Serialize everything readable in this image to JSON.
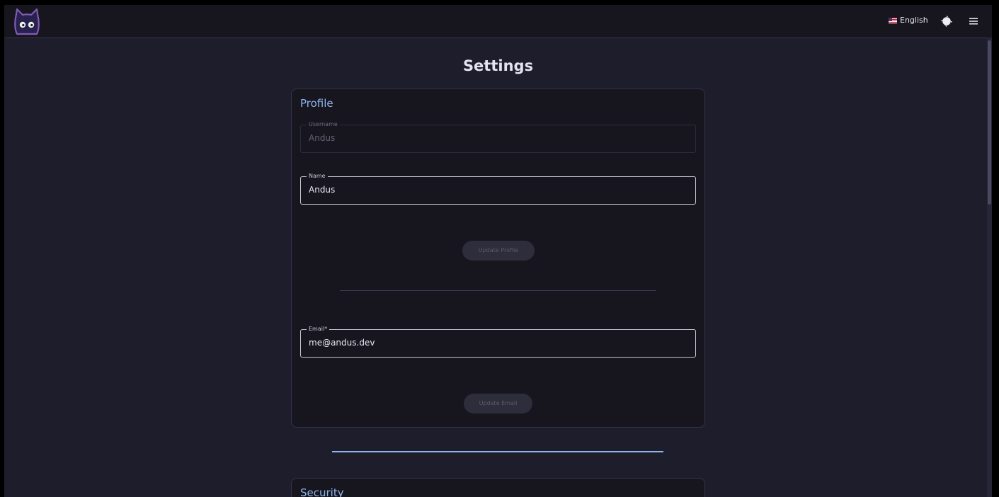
{
  "header": {
    "language": "English",
    "theme_icon": "contrast-icon",
    "menu_icon": "hamburger-menu-icon"
  },
  "page": {
    "title": "Settings"
  },
  "profile": {
    "title": "Profile",
    "username": {
      "label": "Username",
      "value": "Andus"
    },
    "name": {
      "label": "Name",
      "value": "Andus"
    },
    "update_profile_label": "Update Profile",
    "email": {
      "label": "Email*",
      "value": "me@andus.dev"
    },
    "update_email_label": "Update Email"
  },
  "security": {
    "title": "Security"
  },
  "colors": {
    "background": "#1e1d2c",
    "surface": "#17161f",
    "accent": "#8fb6ec",
    "logo_purple": "#7e5cb0"
  }
}
